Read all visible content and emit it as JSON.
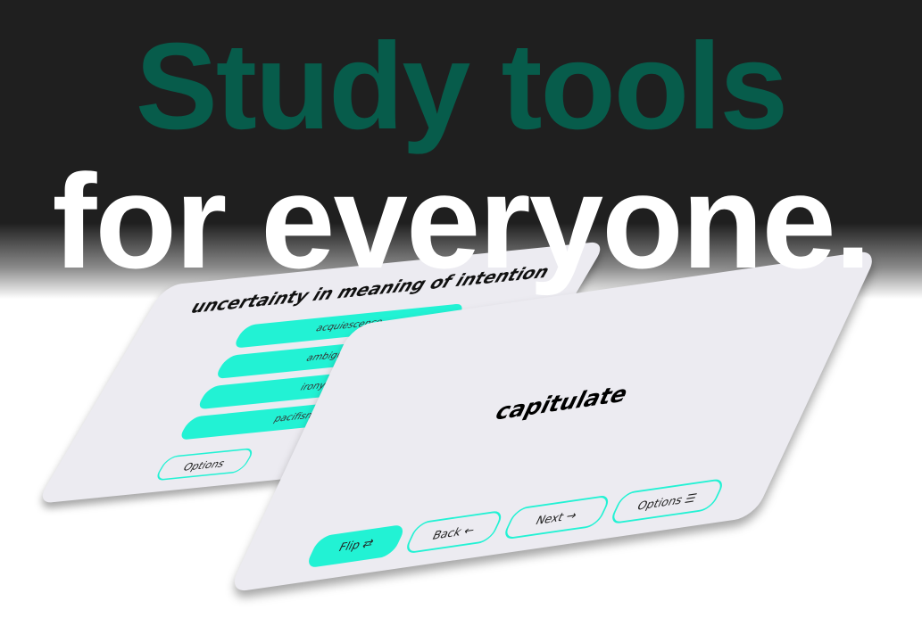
{
  "headline": {
    "line1": "Study tools",
    "line2": "for everyone."
  },
  "quiz_card": {
    "question": "uncertainty in meaning of intention",
    "choices": [
      "acquiescence",
      "ambiguity",
      "irony",
      "pacifism"
    ],
    "options_label": "Options"
  },
  "flash_card": {
    "term": "capitulate",
    "buttons": {
      "flip": "Flip ⇄",
      "back": "Back ←",
      "next": "Next →",
      "options": "Options ☰"
    }
  },
  "colors": {
    "accent": "#22f2d4",
    "heading": "#075c4b"
  }
}
